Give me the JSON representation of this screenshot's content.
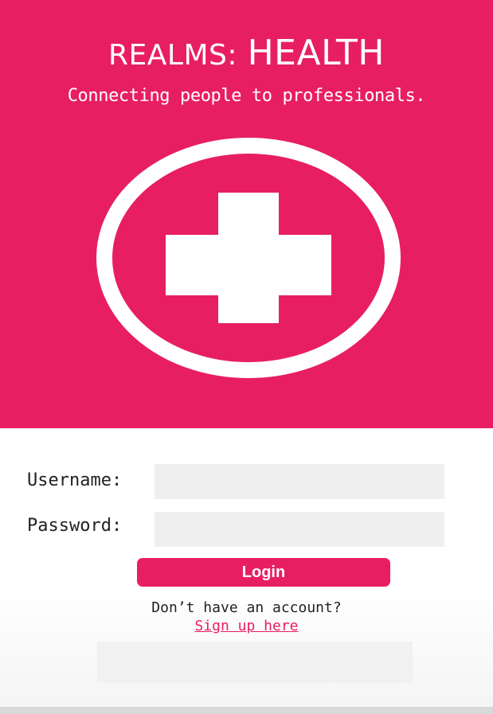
{
  "app": {
    "title_part1": "REALMS:",
    "title_part2": "HEALTH",
    "tagline": "Connecting people to professionals."
  },
  "logo": {
    "icon": "medical-cross-icon"
  },
  "form": {
    "username_label": "Username:",
    "username_value": "",
    "password_label": "Password:",
    "password_value": "",
    "login_label": "Login",
    "no_account_text": "Don’t have an account?",
    "signup_link": "Sign up here"
  },
  "colors": {
    "brand": "#e81e63",
    "input_bg": "#efefef",
    "text": "#222222"
  }
}
